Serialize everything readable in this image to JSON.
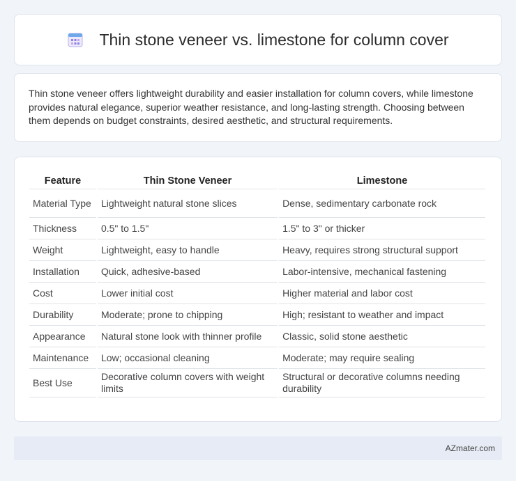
{
  "header": {
    "title": "Thin stone veneer vs. limestone for column cover",
    "icon": "calendar-icon"
  },
  "summary": "Thin stone veneer offers lightweight durability and easier installation for column covers, while limestone provides natural elegance, superior weather resistance, and long-lasting strength. Choosing between them depends on budget constraints, desired aesthetic, and structural requirements.",
  "table": {
    "columns": [
      "Feature",
      "Thin Stone Veneer",
      "Limestone"
    ],
    "rows": [
      [
        "Material Type",
        "Lightweight natural stone slices",
        "Dense, sedimentary carbonate rock"
      ],
      [
        "Thickness",
        "0.5\" to 1.5\"",
        "1.5\" to 3\" or thicker"
      ],
      [
        "Weight",
        "Lightweight, easy to handle",
        "Heavy, requires strong structural support"
      ],
      [
        "Installation",
        "Quick, adhesive-based",
        "Labor-intensive, mechanical fastening"
      ],
      [
        "Cost",
        "Lower initial cost",
        "Higher material and labor cost"
      ],
      [
        "Durability",
        "Moderate; prone to chipping",
        "High; resistant to weather and impact"
      ],
      [
        "Appearance",
        "Natural stone look with thinner profile",
        "Classic, solid stone aesthetic"
      ],
      [
        "Maintenance",
        "Low; occasional cleaning",
        "Moderate; may require sealing"
      ],
      [
        "Best Use",
        "Decorative column covers with weight limits",
        "Structural or decorative columns needing durability"
      ]
    ]
  },
  "footer": {
    "site": "AZmater.com"
  },
  "colors": {
    "background": "#f1f4f9",
    "card": "#ffffff",
    "footer_bg": "#e6ebf5",
    "icon_accent": "#7b6fd6"
  }
}
